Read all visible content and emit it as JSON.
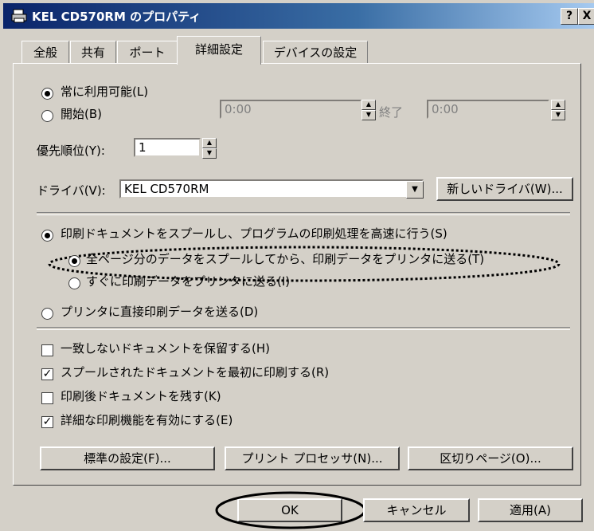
{
  "window": {
    "title": "KEL CD570RM のプロパティ",
    "help_label": "?",
    "close_label": "X"
  },
  "tabs": [
    {
      "label": "全般"
    },
    {
      "label": "共有"
    },
    {
      "label": "ポート"
    },
    {
      "label": "詳細設定"
    },
    {
      "label": "デバイスの設定"
    }
  ],
  "schedule": {
    "always_label": "常に利用可能(L)",
    "start_label": "開始(B)",
    "start_value": "0:00",
    "end_label": "終了",
    "end_value": "0:00"
  },
  "priority": {
    "label": "優先順位(Y):",
    "value": "1"
  },
  "driver": {
    "label": "ドライバ(V):",
    "value": "KEL CD570RM",
    "new_button": "新しいドライバ(W)..."
  },
  "spool": {
    "spool_label": "印刷ドキュメントをスプールし、プログラムの印刷処理を高速に行う(S)",
    "after_last_label": "全ページ分のデータをスプールしてから、印刷データをプリンタに送る(T)",
    "immediately_label": "すぐに印刷データをプリンタに送る(I)",
    "direct_label": "プリンタに直接印刷データを送る(D)"
  },
  "options": [
    {
      "label": "一致しないドキュメントを保留する(H)",
      "checked": false
    },
    {
      "label": "スプールされたドキュメントを最初に印刷する(R)",
      "checked": true
    },
    {
      "label": "印刷後ドキュメントを残す(K)",
      "checked": false
    },
    {
      "label": "詳細な印刷機能を有効にする(E)",
      "checked": true
    }
  ],
  "panel_buttons": {
    "defaults": "標準の設定(F)...",
    "processor": "プリント プロセッサ(N)...",
    "separator": "区切りページ(O)..."
  },
  "footer": {
    "ok": "OK",
    "cancel": "キャンセル",
    "apply": "適用(A)"
  },
  "colors": {
    "title_start": "#0a246a",
    "title_end": "#a6caf0",
    "face": "#d4d0c8"
  }
}
